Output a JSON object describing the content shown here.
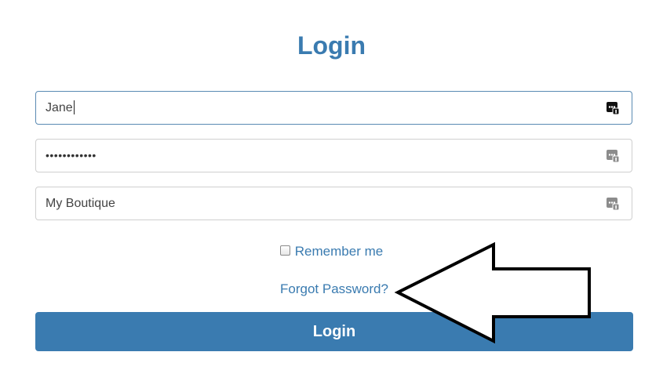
{
  "title": "Login",
  "fields": {
    "username": {
      "value": "Jane",
      "icon": "password-manager-key-icon"
    },
    "password": {
      "value": "••••••••••••",
      "icon": "password-manager-key-icon"
    },
    "store": {
      "value": "My Boutique",
      "icon": "password-manager-key-icon"
    }
  },
  "remember": {
    "label": "Remember me",
    "checked": false
  },
  "forgot_link": "Forgot Password?",
  "login_button": "Login",
  "annotation": {
    "icon": "arrow-annotation-icon"
  },
  "colors": {
    "accent": "#3a7bb0",
    "input_border": "#cfcfcf",
    "focus_border": "#5a8ab3"
  }
}
